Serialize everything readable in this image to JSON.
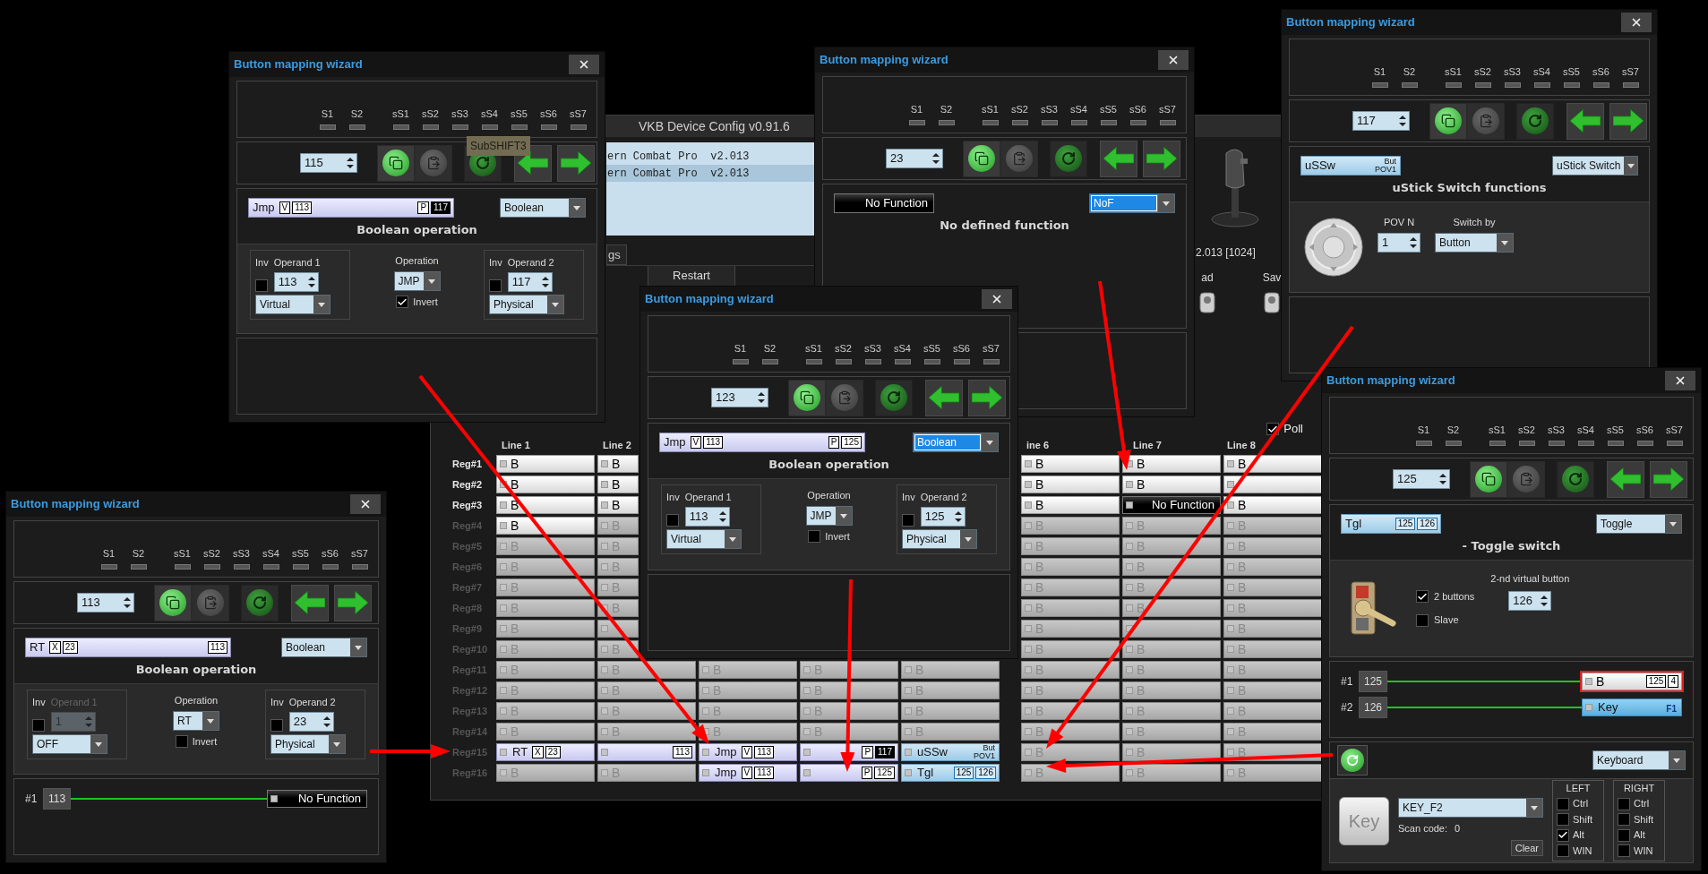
{
  "main_window": {
    "title": "VKB Device Config v0.91.6",
    "devices": [
      {
        "text": "ern Combat Pro  v2.013",
        "selected": false
      },
      {
        "text": "ern Combat Pro  v2.013",
        "selected": true
      }
    ],
    "tab": "gs",
    "restart": "Restart",
    "firmware": "2.013 [1024]",
    "toolbar": [
      "ad",
      "Sav"
    ],
    "poll": {
      "label": "Poll",
      "checked": true
    },
    "grid": {
      "headers_left": [
        "Line 1",
        "Line 2"
      ],
      "headers_right": [
        "ine 6",
        "Line 7",
        "Line 8"
      ],
      "rows": [
        {
          "label": "Reg#1",
          "enabled": true,
          "cells_left": [
            {
              "kind": "button",
              "active": true,
              "label": "B"
            },
            {
              "kind": "button",
              "active": true,
              "label": "B"
            }
          ],
          "cells_right": [
            {
              "kind": "button",
              "active": true,
              "label": "B"
            },
            {
              "kind": "button",
              "active": true,
              "label": "B"
            },
            {
              "kind": "button",
              "active": true,
              "label": "B"
            }
          ]
        },
        {
          "label": "Reg#2",
          "enabled": true,
          "cells_left": [
            {
              "kind": "button",
              "active": true,
              "label": "B"
            },
            {
              "kind": "button",
              "active": true,
              "label": "B"
            }
          ],
          "cells_right": [
            {
              "kind": "button",
              "active": true,
              "label": "B"
            },
            {
              "kind": "button",
              "active": true,
              "label": "B"
            },
            {
              "kind": "button",
              "active": true
            }
          ]
        },
        {
          "label": "Reg#3",
          "enabled": true,
          "cells_left": [
            {
              "kind": "button",
              "active": true,
              "label": "B"
            },
            {
              "kind": "button",
              "active": true,
              "label": "B"
            }
          ],
          "cells_right": [
            {
              "kind": "button",
              "active": true,
              "label": "B"
            },
            {
              "kind": "none",
              "right": [
                {
                  "kind": "text",
                  "text": "No Function"
                }
              ]
            },
            {
              "kind": "button",
              "active": true,
              "label": "B"
            }
          ]
        },
        {
          "label": "Reg#4",
          "enabled": false,
          "cells_left": [
            {
              "kind": "button",
              "active": true,
              "label": "B"
            },
            {
              "kind": "button",
              "active": false,
              "label": "B"
            }
          ],
          "cells_right": [
            {
              "kind": "button",
              "active": false,
              "label": "B"
            },
            {
              "kind": "button",
              "active": false,
              "label": "B"
            },
            {
              "kind": "button",
              "active": false,
              "label": "B"
            }
          ]
        },
        {
          "label": "Reg#5",
          "enabled": false,
          "cells_left": [
            {
              "kind": "button",
              "active": false,
              "label": "B"
            },
            {
              "kind": "button",
              "active": false,
              "label": "B"
            }
          ],
          "cells_right": [
            {
              "kind": "button",
              "active": false,
              "label": "B"
            },
            {
              "kind": "button",
              "active": false,
              "label": "B"
            },
            {
              "kind": "button",
              "active": false,
              "label": "B"
            }
          ]
        },
        {
          "label": "Reg#6",
          "enabled": false,
          "cells_left": [
            {
              "kind": "button",
              "active": false,
              "label": "B"
            },
            {
              "kind": "button",
              "active": false,
              "label": "B"
            }
          ],
          "cells_right": [
            {
              "kind": "button",
              "active": false,
              "label": "B"
            },
            {
              "kind": "button",
              "active": false,
              "label": "B"
            },
            {
              "kind": "button",
              "active": false,
              "label": "B"
            }
          ]
        },
        {
          "label": "Reg#7",
          "enabled": false,
          "cells_left": [
            {
              "kind": "button",
              "active": false,
              "label": "B"
            },
            {
              "kind": "button",
              "active": false,
              "label": "B"
            }
          ],
          "cells_right": [
            {
              "kind": "button",
              "active": false,
              "label": "B"
            },
            {
              "kind": "button",
              "active": false,
              "label": "B"
            },
            {
              "kind": "button",
              "active": false,
              "label": "B"
            }
          ]
        },
        {
          "label": "Reg#8",
          "enabled": false,
          "cells_left": [
            {
              "kind": "button",
              "active": false,
              "label": "B"
            },
            {
              "kind": "button",
              "active": false,
              "label": "B"
            }
          ],
          "cells_right": [
            {
              "kind": "button",
              "active": false,
              "label": "B"
            },
            {
              "kind": "button",
              "active": false,
              "label": "B"
            },
            {
              "kind": "button",
              "active": false,
              "label": "B"
            }
          ]
        },
        {
          "label": "Reg#9",
          "enabled": false,
          "cells_left": [
            {
              "kind": "button",
              "active": false,
              "label": "B"
            },
            {
              "kind": "button",
              "active": false
            }
          ],
          "cells_right": [
            {
              "kind": "button",
              "active": false,
              "label": "B"
            },
            {
              "kind": "button",
              "active": false
            },
            {
              "kind": "button",
              "active": false,
              "label": "B"
            }
          ]
        },
        {
          "label": "Reg#10",
          "enabled": false,
          "cells_left": [
            {
              "kind": "button",
              "active": false,
              "label": "B"
            },
            {
              "kind": "button",
              "active": false,
              "label": "B"
            }
          ],
          "cells_right": [
            {
              "kind": "button",
              "active": false,
              "label": "B"
            },
            {
              "kind": "button",
              "active": false,
              "label": "B"
            },
            {
              "kind": "button",
              "active": false,
              "label": "B"
            }
          ]
        },
        {
          "label": "Reg#11",
          "enabled": false,
          "cells_left": [
            {
              "kind": "button",
              "active": false,
              "label": "B"
            },
            {
              "kind": "button",
              "active": false,
              "label": "B"
            }
          ],
          "cells_middle": [
            {
              "kind": "button",
              "active": false,
              "label": "B"
            },
            {
              "kind": "button",
              "active": false,
              "label": "B"
            },
            {
              "kind": "button",
              "active": false,
              "label": "B"
            }
          ],
          "cells_right": [
            {
              "kind": "button",
              "active": false,
              "label": "B"
            },
            {
              "kind": "button",
              "active": false,
              "label": "B"
            },
            {
              "kind": "button",
              "active": false,
              "label": "B"
            }
          ]
        },
        {
          "label": "Reg#12",
          "enabled": false,
          "cells_left": [
            {
              "kind": "button",
              "active": false,
              "label": "B"
            },
            {
              "kind": "button",
              "active": false,
              "label": "B"
            }
          ],
          "cells_middle": [
            {
              "kind": "button",
              "active": false,
              "label": "B"
            },
            {
              "kind": "button",
              "active": false,
              "label": "B"
            },
            {
              "kind": "button",
              "active": false,
              "label": "B"
            }
          ],
          "cells_right": [
            {
              "kind": "button",
              "active": false,
              "label": "B"
            },
            {
              "kind": "button",
              "active": false,
              "label": "B"
            },
            {
              "kind": "button",
              "active": false,
              "label": "B"
            }
          ]
        },
        {
          "label": "Reg#13",
          "enabled": false,
          "cells_left": [
            {
              "kind": "button",
              "active": false,
              "label": "B"
            },
            {
              "kind": "button",
              "active": false,
              "label": "B"
            }
          ],
          "cells_middle": [
            {
              "kind": "button",
              "active": false,
              "label": "B"
            },
            {
              "kind": "button",
              "active": false,
              "label": "B"
            },
            {
              "kind": "button",
              "active": false,
              "label": "B"
            }
          ],
          "cells_right": [
            {
              "kind": "button",
              "active": false,
              "label": "B"
            },
            {
              "kind": "button",
              "active": false,
              "label": "B"
            },
            {
              "kind": "button",
              "active": false,
              "label": "B"
            }
          ]
        },
        {
          "label": "Reg#14",
          "enabled": false,
          "cells_left": [
            {
              "kind": "button",
              "active": false,
              "label": "B"
            },
            {
              "kind": "button",
              "active": false,
              "label": "B"
            }
          ],
          "cells_middle": [
            {
              "kind": "button",
              "active": false,
              "label": "B"
            },
            {
              "kind": "button",
              "active": false,
              "label": "B"
            },
            {
              "kind": "button",
              "active": false,
              "label": "B"
            }
          ],
          "cells_right": [
            {
              "kind": "button",
              "active": false,
              "label": "B"
            },
            {
              "kind": "button",
              "active": false,
              "label": "B"
            },
            {
              "kind": "button",
              "active": false,
              "label": "B"
            }
          ]
        },
        {
          "label": "Reg#15",
          "enabled": false,
          "cells_left": [
            {
              "kind": "boolean",
              "left": [
                {
                  "kind": "text",
                  "text": "RT"
                },
                {
                  "kind": "tag",
                  "text": "X"
                },
                {
                  "kind": "tag",
                  "text": "23"
                }
              ]
            },
            {
              "kind": "boolean",
              "right": [
                {
                  "kind": "tag",
                  "text": "113"
                }
              ]
            }
          ],
          "cells_middle": [
            {
              "kind": "boolean",
              "left": [
                {
                  "kind": "text",
                  "text": "Jmp"
                },
                {
                  "kind": "tag",
                  "text": "V"
                },
                {
                  "kind": "tag",
                  "text": "113"
                }
              ]
            },
            {
              "kind": "boolean",
              "right": [
                {
                  "kind": "tag",
                  "text": "P"
                },
                {
                  "kind": "tag-dark",
                  "text": "117"
                }
              ]
            },
            {
              "kind": "switch",
              "left": [
                {
                  "kind": "text",
                  "text": "uSSw"
                }
              ],
              "right": [
                {
                  "kind": "stack",
                  "lines": [
                    "But",
                    "POV1"
                  ]
                }
              ]
            }
          ],
          "cells_right": [
            {
              "kind": "button",
              "active": false,
              "label": "B"
            },
            {
              "kind": "button",
              "active": false,
              "label": "B"
            },
            {
              "kind": "button",
              "active": false,
              "label": "B"
            }
          ]
        },
        {
          "label": "Reg#16",
          "enabled": false,
          "cells_left": [
            {
              "kind": "button",
              "active": false,
              "label": "B"
            },
            {
              "kind": "button",
              "active": false,
              "label": "B"
            }
          ],
          "cells_middle": [
            {
              "kind": "boolean",
              "left": [
                {
                  "kind": "text",
                  "text": "Jmp"
                },
                {
                  "kind": "tag",
                  "text": "V"
                },
                {
                  "kind": "tag",
                  "text": "113"
                }
              ]
            },
            {
              "kind": "boolean",
              "right": [
                {
                  "kind": "tag",
                  "text": "P"
                },
                {
                  "kind": "tag",
                  "text": "125"
                }
              ]
            },
            {
              "kind": "switch",
              "left": [
                {
                  "kind": "text",
                  "text": "Tgl"
                }
              ],
              "right": [
                {
                  "kind": "tag",
                  "text": "125"
                },
                {
                  "kind": "tag",
                  "text": "126"
                }
              ]
            }
          ],
          "cells_right": [
            {
              "kind": "button",
              "active": false,
              "label": "B"
            },
            {
              "kind": "button",
              "active": false,
              "label": "B"
            },
            {
              "kind": "button",
              "active": false,
              "label": "B"
            }
          ]
        }
      ]
    }
  },
  "wizards": [
    {
      "title": "Button mapping wizard",
      "shifts": [
        {
          "label": "S1",
          "on": false
        },
        {
          "label": "S2",
          "on": false
        },
        {
          "label": "sS1",
          "on": false
        },
        {
          "label": "sS2",
          "on": false
        },
        {
          "label": "sS3",
          "on": false
        },
        {
          "label": "sS4",
          "on": false
        },
        {
          "label": "sS5",
          "on": false
        },
        {
          "label": "sS6",
          "on": false
        },
        {
          "label": "sS7",
          "on": false
        }
      ],
      "button": "115",
      "tooltip": "SubSHIFT3",
      "function": {
        "strip": {
          "kind": "boolean",
          "left": [
            {
              "kind": "text",
              "text": "Jmp"
            },
            {
              "kind": "tag",
              "text": "V"
            },
            {
              "kind": "tag",
              "text": "113"
            }
          ],
          "right": [
            {
              "kind": "tag",
              "text": "P"
            },
            {
              "kind": "tag-dark",
              "text": "117"
            }
          ]
        },
        "type": "Boolean",
        "type_focused": false,
        "heading": "Boolean operation"
      },
      "detail": {
        "kind": "boolean",
        "operand1": {
          "inv_label": "Inv",
          "label": "Operand 1",
          "inverted": false,
          "value": "113",
          "source": "Virtual",
          "disabled": false
        },
        "operation": {
          "label": "Operation",
          "value": "JMP",
          "invert_label": "Invert",
          "invert": true
        },
        "operand2": {
          "inv_label": "Inv",
          "label": "Operand 2",
          "inverted": false,
          "value": "117",
          "source": "Physical",
          "disabled": false
        }
      }
    },
    {
      "title": "Button mapping wizard",
      "shifts": [
        {
          "label": "S1",
          "on": false
        },
        {
          "label": "S2",
          "on": false
        },
        {
          "label": "sS1",
          "on": false
        },
        {
          "label": "sS2",
          "on": false
        },
        {
          "label": "sS3",
          "on": false
        },
        {
          "label": "sS4",
          "on": false
        },
        {
          "label": "sS5",
          "on": false
        },
        {
          "label": "sS6",
          "on": false
        },
        {
          "label": "sS7",
          "on": false
        }
      ],
      "button": "23",
      "function": {
        "strip": {
          "kind": "none",
          "right": [
            {
              "kind": "text",
              "text": "No Function"
            }
          ]
        },
        "type": "NoF",
        "type_focused": true,
        "heading": "No defined function"
      },
      "detail": {
        "kind": "none"
      }
    },
    {
      "title": "Button mapping wizard",
      "shifts": [
        {
          "label": "S1",
          "on": false
        },
        {
          "label": "S2",
          "on": false
        },
        {
          "label": "sS1",
          "on": false
        },
        {
          "label": "sS2",
          "on": false
        },
        {
          "label": "sS3",
          "on": false
        },
        {
          "label": "sS4",
          "on": false
        },
        {
          "label": "sS5",
          "on": false
        },
        {
          "label": "sS6",
          "on": false
        },
        {
          "label": "sS7",
          "on": false
        }
      ],
      "button": "117",
      "function": {
        "strip": {
          "kind": "switch",
          "left": [
            {
              "kind": "text",
              "text": "uSSw"
            }
          ],
          "right": [
            {
              "kind": "stack",
              "lines": [
                "But",
                "POV1"
              ]
            }
          ]
        },
        "type": "uStick Switch",
        "type_focused": false,
        "heading": "uStick Switch functions"
      },
      "detail": {
        "kind": "ustick",
        "pov_label": "POV N",
        "pov": "1",
        "switch_label": "Switch by",
        "switch": "Button"
      }
    },
    {
      "title": "Button mapping wizard",
      "shifts": [
        {
          "label": "S1",
          "on": false
        },
        {
          "label": "S2",
          "on": false
        },
        {
          "label": "sS1",
          "on": false
        },
        {
          "label": "sS2",
          "on": false
        },
        {
          "label": "sS3",
          "on": false
        },
        {
          "label": "sS4",
          "on": false
        },
        {
          "label": "sS5",
          "on": false
        },
        {
          "label": "sS6",
          "on": false
        },
        {
          "label": "sS7",
          "on": false
        }
      ],
      "button": "123",
      "function": {
        "strip": {
          "kind": "boolean",
          "left": [
            {
              "kind": "text",
              "text": "Jmp"
            },
            {
              "kind": "tag",
              "text": "V"
            },
            {
              "kind": "tag",
              "text": "113"
            }
          ],
          "right": [
            {
              "kind": "tag",
              "text": "P"
            },
            {
              "kind": "tag",
              "text": "125"
            }
          ]
        },
        "type": "Boolean",
        "type_focused": true,
        "heading": "Boolean operation"
      },
      "detail": {
        "kind": "boolean",
        "operand1": {
          "inv_label": "Inv",
          "label": "Operand 1",
          "inverted": false,
          "value": "113",
          "source": "Virtual",
          "disabled": false
        },
        "operation": {
          "label": "Operation",
          "value": "JMP",
          "invert_label": "Invert",
          "invert": false
        },
        "operand2": {
          "inv_label": "Inv",
          "label": "Operand 2",
          "inverted": false,
          "value": "125",
          "source": "Physical",
          "disabled": false
        }
      }
    },
    {
      "title": "Button mapping wizard",
      "shifts": [
        {
          "label": "S1",
          "on": false
        },
        {
          "label": "S2",
          "on": false
        },
        {
          "label": "sS1",
          "on": false
        },
        {
          "label": "sS2",
          "on": false
        },
        {
          "label": "sS3",
          "on": false
        },
        {
          "label": "sS4",
          "on": false
        },
        {
          "label": "sS5",
          "on": false
        },
        {
          "label": "sS6",
          "on": false
        },
        {
          "label": "sS7",
          "on": false
        }
      ],
      "button": "113",
      "function": {
        "strip": {
          "kind": "boolean",
          "left": [
            {
              "kind": "text",
              "text": "RT"
            },
            {
              "kind": "tag",
              "text": "X"
            },
            {
              "kind": "tag",
              "text": "23"
            }
          ],
          "right": [
            {
              "kind": "tag",
              "text": "113"
            }
          ]
        },
        "type": "Boolean",
        "type_focused": false,
        "heading": "Boolean operation"
      },
      "detail": {
        "kind": "boolean",
        "operand1": {
          "inv_label": "Inv",
          "label": "Operand 1",
          "inverted": false,
          "value": "1",
          "source": "OFF",
          "disabled": true
        },
        "operation": {
          "label": "Operation",
          "value": "RT",
          "invert_label": "Invert",
          "invert": false
        },
        "operand2": {
          "inv_label": "Inv",
          "label": "Operand 2",
          "inverted": false,
          "value": "23",
          "source": "Physical",
          "disabled": false
        }
      },
      "links": [
        {
          "label": "#1",
          "number": "113",
          "target": {
            "kind": "none",
            "selected": false,
            "right": [
              {
                "kind": "text",
                "text": "No Function"
              }
            ]
          }
        }
      ]
    },
    {
      "title": "Button mapping wizard",
      "shifts": [
        {
          "label": "S1",
          "on": false
        },
        {
          "label": "S2",
          "on": false
        },
        {
          "label": "sS1",
          "on": false
        },
        {
          "label": "sS2",
          "on": false
        },
        {
          "label": "sS3",
          "on": false
        },
        {
          "label": "sS4",
          "on": false
        },
        {
          "label": "sS5",
          "on": false
        },
        {
          "label": "sS6",
          "on": false
        },
        {
          "label": "sS7",
          "on": false
        }
      ],
      "button": "125",
      "function": {
        "strip": {
          "kind": "switch",
          "left": [
            {
              "kind": "text",
              "text": "Tgl"
            }
          ],
          "right": [
            {
              "kind": "tag",
              "text": "125"
            },
            {
              "kind": "tag",
              "text": "126"
            }
          ]
        },
        "type": "Toggle",
        "type_focused": false,
        "heading": "- Toggle switch"
      },
      "detail": {
        "kind": "toggle",
        "options": [
          {
            "label": "2 buttons",
            "checked": true
          },
          {
            "label": "Slave",
            "checked": false
          }
        ],
        "second_label": "2-nd virtual button",
        "second": "126"
      },
      "links": [
        {
          "label": "#1",
          "number": "125",
          "target": {
            "kind": "button",
            "active": true,
            "selected": true,
            "label": "B",
            "right": [
              {
                "kind": "tag",
                "text": "125"
              },
              {
                "kind": "tag",
                "text": "4"
              }
            ]
          }
        },
        {
          "label": "#2",
          "number": "126",
          "target": {
            "kind": "key",
            "selected": false,
            "left": [
              {
                "kind": "text",
                "text": "Key"
              }
            ],
            "right": [
              {
                "kind": "sub",
                "text": "F1"
              }
            ]
          }
        }
      ],
      "keyboard": {
        "type": "Keyboard",
        "keycap": "Key",
        "key": "KEY_F2",
        "scan_label": "Scan code:",
        "scan": "0",
        "clear": "Clear",
        "groups": [
          {
            "title": "LEFT",
            "mods": [
              {
                "label": "Ctrl",
                "checked": false
              },
              {
                "label": "Shift",
                "checked": false
              },
              {
                "label": "Alt",
                "checked": true
              },
              {
                "label": "WIN",
                "checked": false
              }
            ]
          },
          {
            "title": "RIGHT",
            "mods": [
              {
                "label": "Ctrl",
                "checked": false
              },
              {
                "label": "Shift",
                "checked": false
              },
              {
                "label": "Alt",
                "checked": false
              },
              {
                "label": "WIN",
                "checked": false
              }
            ]
          }
        ]
      }
    }
  ]
}
